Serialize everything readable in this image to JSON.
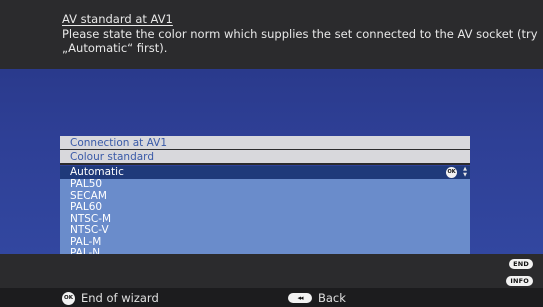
{
  "header": {
    "title": "AV standard at AV1",
    "description": "Please state the color norm which supplies the set connected to the AV socket (try „Automatic“ first)."
  },
  "menu": {
    "heading1": "Connection at AV1",
    "heading2": "Colour standard",
    "selected": "Automatic",
    "options": [
      "PAL50",
      "SECAM",
      "PAL60",
      "NTSC-M",
      "NTSC-V",
      "PAL-M",
      "PAL-N"
    ]
  },
  "footer": {
    "ok_label": "End of wizard",
    "back_label": "Back",
    "end_badge": "END",
    "info_badge": "INFO",
    "ok_icon_text": "OK",
    "back_icon_text": "◂◂"
  },
  "colors": {
    "background": "#2b2b2d",
    "blue_area": "#3247a0",
    "selected_row": "#1f3a7a",
    "options_bg": "#6a8ccb",
    "heading_bg": "#d8d8dc",
    "heading_text": "#3a5aa8"
  }
}
